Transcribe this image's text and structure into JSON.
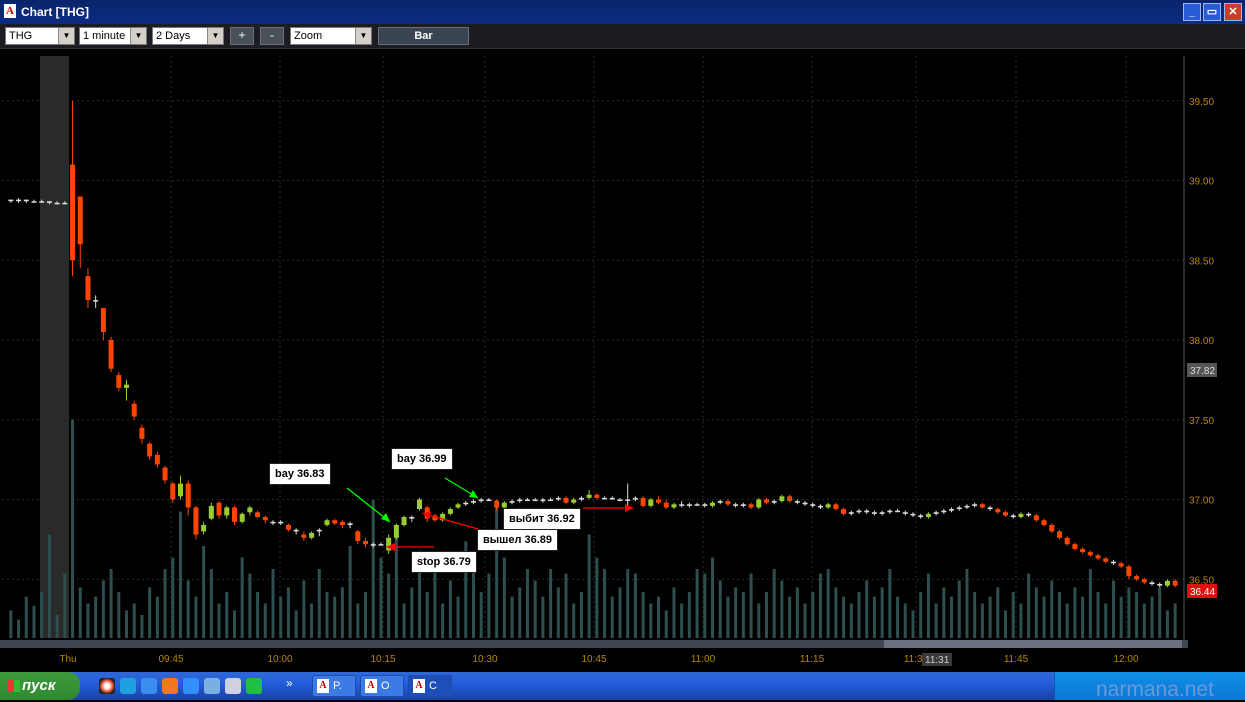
{
  "window": {
    "title": "Chart [THG]",
    "min_label": "_",
    "max_label": "▭",
    "close_label": "✕"
  },
  "toolbar": {
    "symbol": "THG",
    "interval": "1 minute",
    "range": "2 Days",
    "plus": "+",
    "minus": "-",
    "zoom": "Zoom",
    "bar_label": "Bar"
  },
  "chart_data": {
    "type": "candlestick",
    "symbol": "THG",
    "ylim": [
      36.2,
      39.8
    ],
    "y_ticks": [
      "39.50",
      "39.00",
      "38.50",
      "38.00",
      "37.50",
      "37.00",
      "36.50"
    ],
    "x_ticks": [
      "Thu",
      "09:45",
      "10:00",
      "10:15",
      "10:30",
      "10:45",
      "11:00",
      "11:15",
      "11:30",
      "11:45",
      "12:00"
    ],
    "price_marker_gray": "37.82",
    "price_marker_red": "36.44",
    "crosshair_time": "11:31",
    "colors": {
      "up": "#9acd32",
      "down": "#ff4500",
      "volume": "#2f4f4f",
      "axis_text": "#b8860b"
    },
    "volume_max": 100,
    "candles": [
      [
        38.88,
        38.88,
        38.86,
        38.87
      ],
      [
        38.87,
        38.89,
        38.86,
        38.88
      ],
      [
        38.88,
        38.88,
        38.86,
        38.87
      ],
      [
        38.87,
        38.88,
        38.86,
        38.87
      ],
      [
        38.87,
        38.88,
        38.86,
        38.87
      ],
      [
        38.87,
        38.87,
        38.85,
        38.86
      ],
      [
        38.86,
        38.87,
        38.85,
        38.86
      ],
      [
        38.86,
        38.87,
        38.85,
        38.86
      ],
      [
        39.1,
        39.5,
        38.4,
        38.5
      ],
      [
        38.9,
        38.9,
        38.45,
        38.6
      ],
      [
        38.4,
        38.45,
        38.2,
        38.25
      ],
      [
        38.25,
        38.28,
        38.2,
        38.25
      ],
      [
        38.2,
        38.2,
        38.0,
        38.05
      ],
      [
        38.0,
        38.02,
        37.8,
        37.82
      ],
      [
        37.78,
        37.8,
        37.68,
        37.7
      ],
      [
        37.7,
        37.75,
        37.62,
        37.72
      ],
      [
        37.6,
        37.62,
        37.5,
        37.52
      ],
      [
        37.45,
        37.47,
        37.35,
        37.38
      ],
      [
        37.35,
        37.36,
        37.25,
        37.27
      ],
      [
        37.28,
        37.3,
        37.2,
        37.22
      ],
      [
        37.2,
        37.21,
        37.1,
        37.12
      ],
      [
        37.1,
        37.11,
        36.98,
        37.0
      ],
      [
        37.02,
        37.15,
        37.0,
        37.1
      ],
      [
        37.1,
        37.12,
        36.9,
        36.95
      ],
      [
        36.95,
        36.96,
        36.75,
        36.78
      ],
      [
        36.8,
        36.86,
        36.78,
        36.84
      ],
      [
        36.88,
        36.98,
        36.87,
        36.96
      ],
      [
        36.98,
        36.99,
        36.88,
        36.9
      ],
      [
        36.9,
        36.96,
        36.88,
        36.95
      ],
      [
        36.95,
        36.96,
        36.84,
        36.86
      ],
      [
        36.86,
        36.92,
        36.85,
        36.91
      ],
      [
        36.92,
        36.96,
        36.9,
        36.95
      ],
      [
        36.92,
        36.93,
        36.88,
        36.89
      ],
      [
        36.89,
        36.9,
        36.85,
        36.87
      ],
      [
        36.86,
        36.87,
        36.84,
        36.86
      ],
      [
        36.86,
        36.87,
        36.84,
        36.85
      ],
      [
        36.84,
        36.85,
        36.8,
        36.81
      ],
      [
        36.81,
        36.82,
        36.78,
        36.8
      ],
      [
        36.78,
        36.8,
        36.74,
        36.76
      ],
      [
        36.76,
        36.8,
        36.75,
        36.79
      ],
      [
        36.8,
        36.82,
        36.77,
        36.81
      ],
      [
        36.84,
        36.88,
        36.83,
        36.87
      ],
      [
        36.87,
        36.88,
        36.84,
        36.85
      ],
      [
        36.86,
        36.87,
        36.82,
        36.84
      ],
      [
        36.84,
        36.86,
        36.82,
        36.85
      ],
      [
        36.8,
        36.81,
        36.72,
        36.74
      ],
      [
        36.74,
        36.76,
        36.7,
        36.72
      ],
      [
        36.72,
        36.73,
        36.7,
        36.72
      ],
      [
        36.72,
        36.73,
        36.71,
        36.72
      ],
      [
        36.68,
        36.78,
        36.66,
        36.76
      ],
      [
        36.76,
        36.85,
        36.75,
        36.84
      ],
      [
        36.84,
        36.9,
        36.83,
        36.89
      ],
      [
        36.89,
        36.9,
        36.86,
        36.88
      ],
      [
        36.94,
        37.01,
        36.93,
        37.0
      ],
      [
        36.95,
        36.96,
        36.86,
        36.88
      ],
      [
        36.9,
        36.91,
        36.86,
        36.87
      ],
      [
        36.87,
        36.92,
        36.86,
        36.91
      ],
      [
        36.91,
        36.95,
        36.9,
        36.94
      ],
      [
        36.95,
        36.98,
        36.94,
        36.97
      ],
      [
        36.97,
        36.99,
        36.96,
        36.98
      ],
      [
        36.98,
        37.0,
        36.97,
        36.99
      ],
      [
        36.99,
        37.01,
        36.98,
        37.0
      ],
      [
        37.0,
        37.01,
        36.99,
        36.99
      ],
      [
        36.99,
        37.0,
        36.93,
        36.95
      ],
      [
        36.95,
        36.99,
        36.94,
        36.98
      ],
      [
        36.98,
        37.0,
        36.97,
        36.99
      ],
      [
        36.99,
        37.01,
        36.98,
        37.0
      ],
      [
        37.0,
        37.01,
        36.99,
        37.0
      ],
      [
        37.0,
        37.01,
        36.99,
        36.99
      ],
      [
        36.99,
        37.01,
        36.98,
        37.0
      ],
      [
        37.0,
        37.01,
        36.99,
        37.0
      ],
      [
        37.0,
        37.02,
        36.99,
        37.01
      ],
      [
        37.01,
        37.02,
        36.97,
        36.98
      ],
      [
        36.98,
        37.01,
        36.97,
        37.0
      ],
      [
        37.0,
        37.02,
        36.99,
        37.01
      ],
      [
        37.01,
        37.06,
        37.0,
        37.03
      ],
      [
        37.03,
        37.04,
        37.0,
        37.01
      ],
      [
        37.01,
        37.02,
        37.0,
        37.01
      ],
      [
        37.01,
        37.02,
        37.0,
        37.0
      ],
      [
        37.0,
        37.01,
        36.99,
        37.0
      ],
      [
        37.0,
        37.1,
        36.96,
        37.0
      ],
      [
        37.0,
        37.02,
        36.99,
        37.01
      ],
      [
        37.01,
        37.02,
        36.95,
        36.96
      ],
      [
        36.96,
        37.01,
        36.95,
        37.0
      ],
      [
        37.0,
        37.02,
        36.97,
        36.98
      ],
      [
        36.98,
        37.0,
        36.94,
        36.95
      ],
      [
        36.95,
        36.98,
        36.94,
        36.97
      ],
      [
        36.97,
        36.99,
        36.95,
        36.96
      ],
      [
        36.96,
        36.98,
        36.95,
        36.97
      ],
      [
        36.97,
        36.98,
        36.96,
        36.97
      ],
      [
        36.97,
        36.98,
        36.95,
        36.96
      ],
      [
        36.96,
        36.99,
        36.95,
        36.98
      ],
      [
        36.98,
        37.0,
        36.97,
        36.99
      ],
      [
        36.99,
        37.0,
        36.96,
        36.97
      ],
      [
        36.97,
        36.98,
        36.95,
        36.96
      ],
      [
        36.96,
        36.98,
        36.95,
        36.97
      ],
      [
        36.97,
        36.98,
        36.94,
        36.95
      ],
      [
        36.95,
        37.01,
        36.94,
        37.0
      ],
      [
        37.0,
        37.01,
        36.97,
        36.98
      ],
      [
        36.98,
        37.0,
        36.97,
        36.99
      ],
      [
        36.99,
        37.03,
        36.98,
        37.02
      ],
      [
        37.02,
        37.03,
        36.98,
        36.99
      ],
      [
        36.99,
        37.0,
        36.97,
        36.98
      ],
      [
        36.98,
        36.99,
        36.96,
        36.97
      ],
      [
        36.97,
        36.98,
        36.95,
        36.96
      ],
      [
        36.96,
        36.97,
        36.94,
        36.95
      ],
      [
        36.95,
        36.98,
        36.94,
        36.97
      ],
      [
        36.97,
        36.98,
        36.93,
        36.94
      ],
      [
        36.94,
        36.95,
        36.9,
        36.91
      ],
      [
        36.91,
        36.93,
        36.9,
        36.92
      ],
      [
        36.92,
        36.94,
        36.91,
        36.93
      ],
      [
        36.93,
        36.94,
        36.91,
        36.92
      ],
      [
        36.92,
        36.93,
        36.9,
        36.91
      ],
      [
        36.91,
        36.93,
        36.9,
        36.92
      ],
      [
        36.92,
        36.94,
        36.91,
        36.93
      ],
      [
        36.93,
        36.94,
        36.92,
        36.93
      ],
      [
        36.92,
        36.93,
        36.9,
        36.91
      ],
      [
        36.91,
        36.92,
        36.89,
        36.9
      ],
      [
        36.9,
        36.91,
        36.88,
        36.89
      ],
      [
        36.89,
        36.92,
        36.88,
        36.91
      ],
      [
        36.91,
        36.93,
        36.9,
        36.92
      ],
      [
        36.92,
        36.94,
        36.91,
        36.93
      ],
      [
        36.93,
        36.95,
        36.92,
        36.94
      ],
      [
        36.94,
        36.96,
        36.93,
        36.95
      ],
      [
        36.95,
        36.97,
        36.94,
        36.96
      ],
      [
        36.96,
        36.98,
        36.95,
        36.97
      ],
      [
        36.97,
        36.98,
        36.94,
        36.95
      ],
      [
        36.95,
        36.96,
        36.93,
        36.94
      ],
      [
        36.94,
        36.95,
        36.91,
        36.92
      ],
      [
        36.92,
        36.93,
        36.89,
        36.9
      ],
      [
        36.9,
        36.91,
        36.88,
        36.89
      ],
      [
        36.89,
        36.92,
        36.88,
        36.91
      ],
      [
        36.91,
        36.92,
        36.89,
        36.9
      ],
      [
        36.9,
        36.91,
        36.86,
        36.87
      ],
      [
        36.87,
        36.88,
        36.83,
        36.84
      ],
      [
        36.84,
        36.85,
        36.79,
        36.8
      ],
      [
        36.8,
        36.81,
        36.75,
        36.76
      ],
      [
        36.76,
        36.77,
        36.71,
        36.72
      ],
      [
        36.72,
        36.73,
        36.68,
        36.69
      ],
      [
        36.69,
        36.7,
        36.66,
        36.67
      ],
      [
        36.67,
        36.68,
        36.64,
        36.65
      ],
      [
        36.65,
        36.66,
        36.62,
        36.63
      ],
      [
        36.63,
        36.64,
        36.6,
        36.61
      ],
      [
        36.61,
        36.62,
        36.59,
        36.6
      ],
      [
        36.6,
        36.61,
        36.57,
        36.58
      ],
      [
        36.58,
        36.59,
        36.5,
        36.52
      ],
      [
        36.52,
        36.53,
        36.49,
        36.5
      ],
      [
        36.5,
        36.51,
        36.47,
        36.48
      ],
      [
        36.48,
        36.49,
        36.46,
        36.47
      ],
      [
        36.47,
        36.48,
        36.45,
        36.46
      ],
      [
        36.46,
        36.5,
        36.45,
        36.49
      ],
      [
        36.49,
        36.5,
        36.45,
        36.46
      ]
    ],
    "volumes": [
      12,
      8,
      18,
      14,
      20,
      45,
      10,
      28,
      95,
      22,
      15,
      18,
      25,
      30,
      20,
      12,
      15,
      10,
      22,
      18,
      30,
      35,
      55,
      25,
      18,
      40,
      30,
      15,
      20,
      12,
      35,
      28,
      20,
      15,
      30,
      18,
      22,
      12,
      25,
      15,
      30,
      20,
      18,
      22,
      40,
      15,
      20,
      60,
      35,
      28,
      45,
      15,
      22,
      38,
      20,
      30,
      15,
      25,
      18,
      42,
      30,
      20,
      28,
      60,
      35,
      18,
      22,
      30,
      25,
      18,
      30,
      22,
      28,
      15,
      20,
      45,
      35,
      30,
      18,
      22,
      30,
      28,
      20,
      15,
      18,
      12,
      22,
      15,
      20,
      30,
      28,
      35,
      25,
      18,
      22,
      20,
      28,
      15,
      20,
      30,
      25,
      18,
      22,
      15,
      20,
      28,
      30,
      22,
      18,
      15,
      20,
      25,
      18,
      22,
      30,
      18,
      15,
      12,
      20,
      28,
      15,
      22,
      18,
      25,
      30,
      20,
      15,
      18,
      22,
      12,
      20,
      15,
      28,
      22,
      18,
      25,
      20,
      15,
      22,
      18,
      30,
      20,
      15,
      25,
      18,
      22,
      20,
      15,
      18,
      22,
      12,
      15
    ]
  },
  "annotations": {
    "bay1": "bay 36.83",
    "bay2": "bay 36.99",
    "stop": "stop 36.79",
    "exit": "вышел 36.89",
    "knocked": "выбит 36.92"
  },
  "taskbar": {
    "start_label": "пуск",
    "task_tag": "A",
    "task1": "P.",
    "task2": "O",
    "task3": "C",
    "more": "»"
  },
  "watermark": "narmana.net"
}
